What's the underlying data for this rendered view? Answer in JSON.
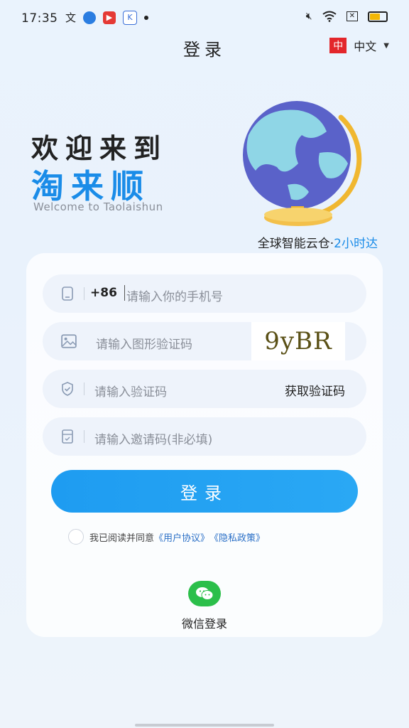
{
  "status_bar": {
    "time": "17:35",
    "left_icons": [
      "translate-icon",
      "blue-app-icon",
      "video-app-icon",
      "ks-app-icon",
      "dot-icon"
    ],
    "right_icons": [
      "mute-icon",
      "wifi-icon",
      "close-box-icon",
      "battery-icon"
    ]
  },
  "header": {
    "title": "登录",
    "lang_badge": "中",
    "lang_label": "中文"
  },
  "hero": {
    "line1": "欢迎来到",
    "line2": "淘来顺",
    "english": "Welcome to Taolaishun",
    "tagline_main": "全球智能云仓·",
    "tagline_highlight": "2小时达"
  },
  "form": {
    "phone_prefix": "+86",
    "phone_placeholder": "请输入你的手机号",
    "captcha_placeholder": "请输入图形验证码",
    "captcha_text": "9yBR",
    "code_placeholder": "请输入验证码",
    "get_code_label": "获取验证码",
    "invite_placeholder": "请输入邀请码(非必填)",
    "login_label": "登录"
  },
  "agreement": {
    "prefix": "我已阅读并同意",
    "user_agreement": "《用户协议》",
    "privacy_policy": "《隐私政策》"
  },
  "social": {
    "wechat_label": "微信登录"
  },
  "colors": {
    "accent": "#1a8ce8",
    "button": "#1e9cf1",
    "wechat": "#2bbf4a",
    "lang_badge": "#e3262b"
  }
}
